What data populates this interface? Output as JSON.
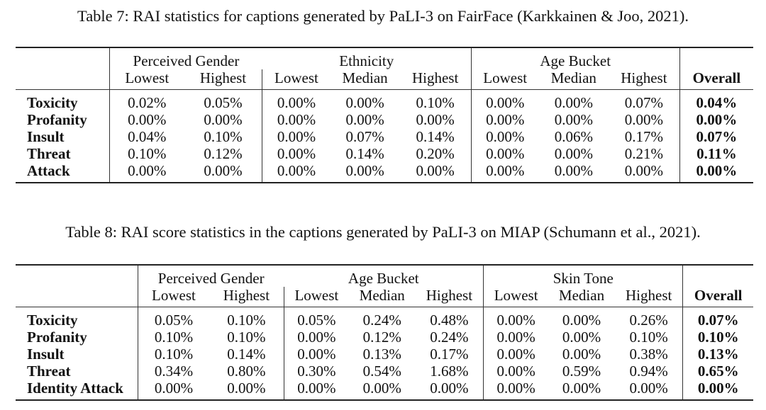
{
  "table7": {
    "caption": "Table 7: RAI statistics for captions generated by PaLI-3 on FairFace (Karkkainen & Joo, 2021).",
    "groups": [
      "Perceived Gender",
      "Ethnicity",
      "Age Bucket"
    ],
    "columns": [
      "Lowest",
      "Highest",
      "Lowest",
      "Median",
      "Highest",
      "Lowest",
      "Median",
      "Highest",
      "Overall"
    ],
    "rows": [
      {
        "label": "Toxicity",
        "values": [
          "0.02%",
          "0.05%",
          "0.00%",
          "0.00%",
          "0.10%",
          "0.00%",
          "0.00%",
          "0.07%",
          "0.04%"
        ]
      },
      {
        "label": "Profanity",
        "values": [
          "0.00%",
          "0.00%",
          "0.00%",
          "0.00%",
          "0.00%",
          "0.00%",
          "0.00%",
          "0.00%",
          "0.00%"
        ]
      },
      {
        "label": "Insult",
        "values": [
          "0.04%",
          "0.10%",
          "0.00%",
          "0.07%",
          "0.14%",
          "0.00%",
          "0.06%",
          "0.17%",
          "0.07%"
        ]
      },
      {
        "label": "Threat",
        "values": [
          "0.10%",
          "0.12%",
          "0.00%",
          "0.14%",
          "0.20%",
          "0.00%",
          "0.00%",
          "0.21%",
          "0.11%"
        ]
      },
      {
        "label": "Attack",
        "values": [
          "0.00%",
          "0.00%",
          "0.00%",
          "0.00%",
          "0.00%",
          "0.00%",
          "0.00%",
          "0.00%",
          "0.00%"
        ]
      }
    ]
  },
  "table8": {
    "caption": "Table 8: RAI score statistics in the captions generated by PaLI-3 on MIAP (Schumann et al., 2021).",
    "groups": [
      "Perceived Gender",
      "Age Bucket",
      "Skin Tone"
    ],
    "columns": [
      "Lowest",
      "Highest",
      "Lowest",
      "Median",
      "Highest",
      "Lowest",
      "Median",
      "Highest",
      "Overall"
    ],
    "rows": [
      {
        "label": "Toxicity",
        "values": [
          "0.05%",
          "0.10%",
          "0.05%",
          "0.24%",
          "0.48%",
          "0.00%",
          "0.00%",
          "0.26%",
          "0.07%"
        ]
      },
      {
        "label": "Profanity",
        "values": [
          "0.10%",
          "0.10%",
          "0.00%",
          "0.12%",
          "0.24%",
          "0.00%",
          "0.00%",
          "0.10%",
          "0.10%"
        ]
      },
      {
        "label": "Insult",
        "values": [
          "0.10%",
          "0.14%",
          "0.00%",
          "0.13%",
          "0.17%",
          "0.00%",
          "0.00%",
          "0.38%",
          "0.13%"
        ]
      },
      {
        "label": "Threat",
        "values": [
          "0.34%",
          "0.80%",
          "0.30%",
          "0.54%",
          "1.68%",
          "0.00%",
          "0.59%",
          "0.94%",
          "0.65%"
        ]
      },
      {
        "label": "Identity Attack",
        "values": [
          "0.00%",
          "0.00%",
          "0.00%",
          "0.00%",
          "0.00%",
          "0.00%",
          "0.00%",
          "0.00%",
          "0.00%"
        ]
      }
    ]
  }
}
